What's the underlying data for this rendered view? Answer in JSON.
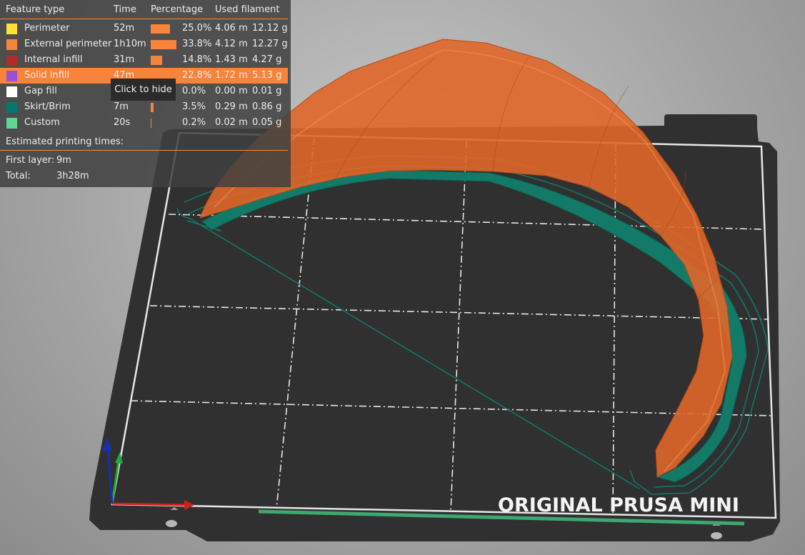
{
  "legend": {
    "headers": {
      "feature_type": "Feature type",
      "time": "Time",
      "percentage": "Percentage",
      "used_filament": "Used filament"
    },
    "rows": [
      {
        "name": "Perimeter",
        "time": "52m",
        "percent": "25.0%",
        "length": "4.06 m",
        "weight": "12.12 g",
        "color": "#ffe135",
        "fraction": 0.25,
        "highlighted": false
      },
      {
        "name": "External perimeter",
        "time": "1h10m",
        "percent": "33.8%",
        "length": "4.12 m",
        "weight": "12.27 g",
        "color": "#f7843a",
        "fraction": 0.338,
        "highlighted": false
      },
      {
        "name": "Internal infill",
        "time": "31m",
        "percent": "14.8%",
        "length": "1.43 m",
        "weight": "4.27 g",
        "color": "#b0292c",
        "fraction": 0.148,
        "highlighted": false
      },
      {
        "name": "Solid infill",
        "time": "47m",
        "percent": "22.8%",
        "length": "1.72 m",
        "weight": "5.13 g",
        "color": "#9b4fd1",
        "fraction": 0.228,
        "highlighted": true
      },
      {
        "name": "Gap fill",
        "time": "",
        "percent": "0.0%",
        "length": "0.00 m",
        "weight": "0.01 g",
        "color": "#ffffff",
        "fraction": 0.0,
        "highlighted": false
      },
      {
        "name": "Skirt/Brim",
        "time": "7m",
        "percent": "3.5%",
        "length": "0.29 m",
        "weight": "0.86 g",
        "color": "#007a6b",
        "fraction": 0.035,
        "highlighted": false
      },
      {
        "name": "Custom",
        "time": "20s",
        "percent": "0.2%",
        "length": "0.02 m",
        "weight": "0.05 g",
        "color": "#5fd594",
        "fraction": 0.002,
        "highlighted": false
      }
    ],
    "tooltip": "Click to hide",
    "estimated_label": "Estimated printing times:",
    "first_layer_label": "First layer:",
    "first_layer_value": "9m",
    "total_label": "Total:",
    "total_value": "3h28m"
  },
  "bed": {
    "label": "ORIGINAL PRUSA MINI",
    "plate_color": "#303030",
    "grid_color": "#e6e6e6",
    "print_color": "#e0672a",
    "brim_color": "#0f7a6a"
  },
  "axes": {
    "x_color": "#d11f1f",
    "y_color": "#22a83a",
    "z_color": "#1a2fb0"
  }
}
